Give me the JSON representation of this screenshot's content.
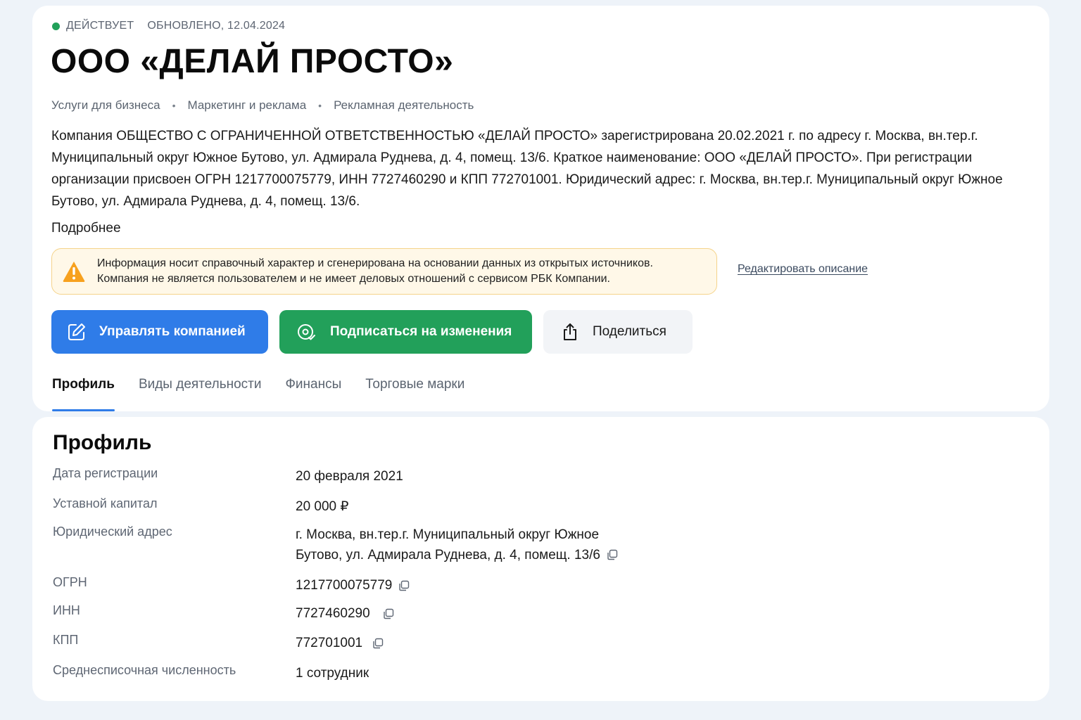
{
  "status": {
    "label": "ДЕЙСТВУЕТ",
    "updated": "ОБНОВЛЕНО, 12.04.2024",
    "color": "#21a15a"
  },
  "company": {
    "title": "ООО «ДЕЛАЙ ПРОСТО»",
    "categories": [
      "Услуги для бизнеса",
      "Маркетинг и реклама",
      "Рекламная деятельность"
    ],
    "separator": "•",
    "description": "Компания ОБЩЕСТВО С ОГРАНИЧЕННОЙ ОТВЕТСТВЕННОСТЬЮ «ДЕЛАЙ ПРОСТО» зарегистрирована 20.02.2021 г. по адресу г. Москва, вн.тер.г. Муниципальный округ Южное Бутово, ул. Адмирала Руднева, д. 4, помещ. 13/6. Краткое наименование: ООО «ДЕЛАЙ ПРОСТО». При регистрации организации присвоен ОГРН 1217700075779, ИНН 7727460290 и КПП 772701001. Юридический адрес: г. Москва, вн.тер.г. Муниципальный округ Южное Бутово, ул. Адмирала Руднева, д. 4, помещ. 13/6.",
    "more_label": "Подробнее"
  },
  "notice": {
    "line1": "Информация носит справочный характер и сгенерирована на основании данных из открытых источников.",
    "line2": "Компания не является пользователем и не имеет деловых отношений с сервисом РБК Компании.",
    "icon": "warning-icon",
    "edit_label": "Редактировать описание"
  },
  "actions": {
    "manage": "Управлять компанией",
    "subscribe": "Подписаться на изменения",
    "share": "Поделиться"
  },
  "tabs": [
    {
      "label": "Профиль",
      "active": true
    },
    {
      "label": "Виды деятельности",
      "active": false
    },
    {
      "label": "Финансы",
      "active": false
    },
    {
      "label": "Торговые марки",
      "active": false
    }
  ],
  "profile": {
    "heading": "Профиль",
    "rows": {
      "reg_date": {
        "label": "Дата регистрации",
        "value": "20 февраля 2021"
      },
      "capital": {
        "label": "Уставной капитал",
        "value": "20 000 ₽"
      },
      "address": {
        "label": "Юридический адрес",
        "line1": "г. Москва, вн.тер.г. Муниципальный округ Южное",
        "line2": "Бутово, ул. Адмирала Руднева, д. 4, помещ. 13/6"
      },
      "ogrn": {
        "label": "ОГРН",
        "value": "1217700075779"
      },
      "inn": {
        "label": "ИНН",
        "value": "7727460290"
      },
      "kpp": {
        "label": "КПП",
        "value": "772701001"
      },
      "employees": {
        "label": "Среднесписочная численность",
        "value": "1 сотрудник"
      }
    }
  },
  "colors": {
    "primary": "#2f7ce8",
    "success": "#22a05a",
    "warning_bg": "#fff8e8",
    "warning_border": "#f5d38a"
  }
}
